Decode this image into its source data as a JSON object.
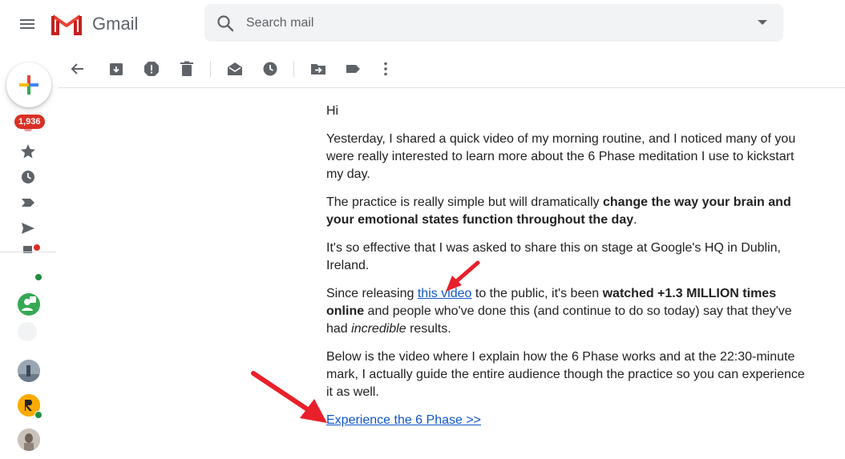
{
  "header": {
    "brand": "Gmail",
    "search_placeholder": "Search mail"
  },
  "sidebar": {
    "inbox_badge": "1,936"
  },
  "colors": {
    "badge": "#d93025",
    "link": "#1155cc",
    "arrow": "#e8202a",
    "online": "#1e8e3e"
  },
  "icons": {
    "toolbar": [
      "back-arrow-icon",
      "archive-icon",
      "report-spam-icon",
      "delete-icon",
      "mark-unread-icon",
      "snooze-icon",
      "move-to-icon",
      "label-icon",
      "more-vert-icon"
    ],
    "sidebar": [
      "compose-plus-icon",
      "inbox-icon",
      "star-icon",
      "clock-icon",
      "important-icon",
      "send-icon",
      "drafts-icon"
    ]
  },
  "email": {
    "greeting": "Hi",
    "p1": "Yesterday, I shared a quick video of my morning routine, and I noticed many of you were really interested to learn more about the 6 Phase meditation I use to kickstart my day.",
    "p2_pre": "The practice is really simple but will dramatically ",
    "p2_bold": "change the way your brain and your emotional states function throughout the day",
    "p2_post": ".",
    "p3": "It's so effective that I was asked to share this on stage at Google's HQ in Dublin, Ireland.",
    "p4_pre": "Since releasing ",
    "p4_link": "this video",
    "p4_mid": " to the public, it's been ",
    "p4_bold": "watched +1.3 MILLION times online",
    "p4_mid2": " and people who've done this (and continue to do so today) say that they've had ",
    "p4_italic": "incredible",
    "p4_post": " results.",
    "p5": "Below is the video where I explain how the 6 Phase works and at the 22:30-minute mark, I actually guide the entire audience though the practice so you can experience it as well.",
    "cta_link": "Experience the 6 Phase >>"
  }
}
